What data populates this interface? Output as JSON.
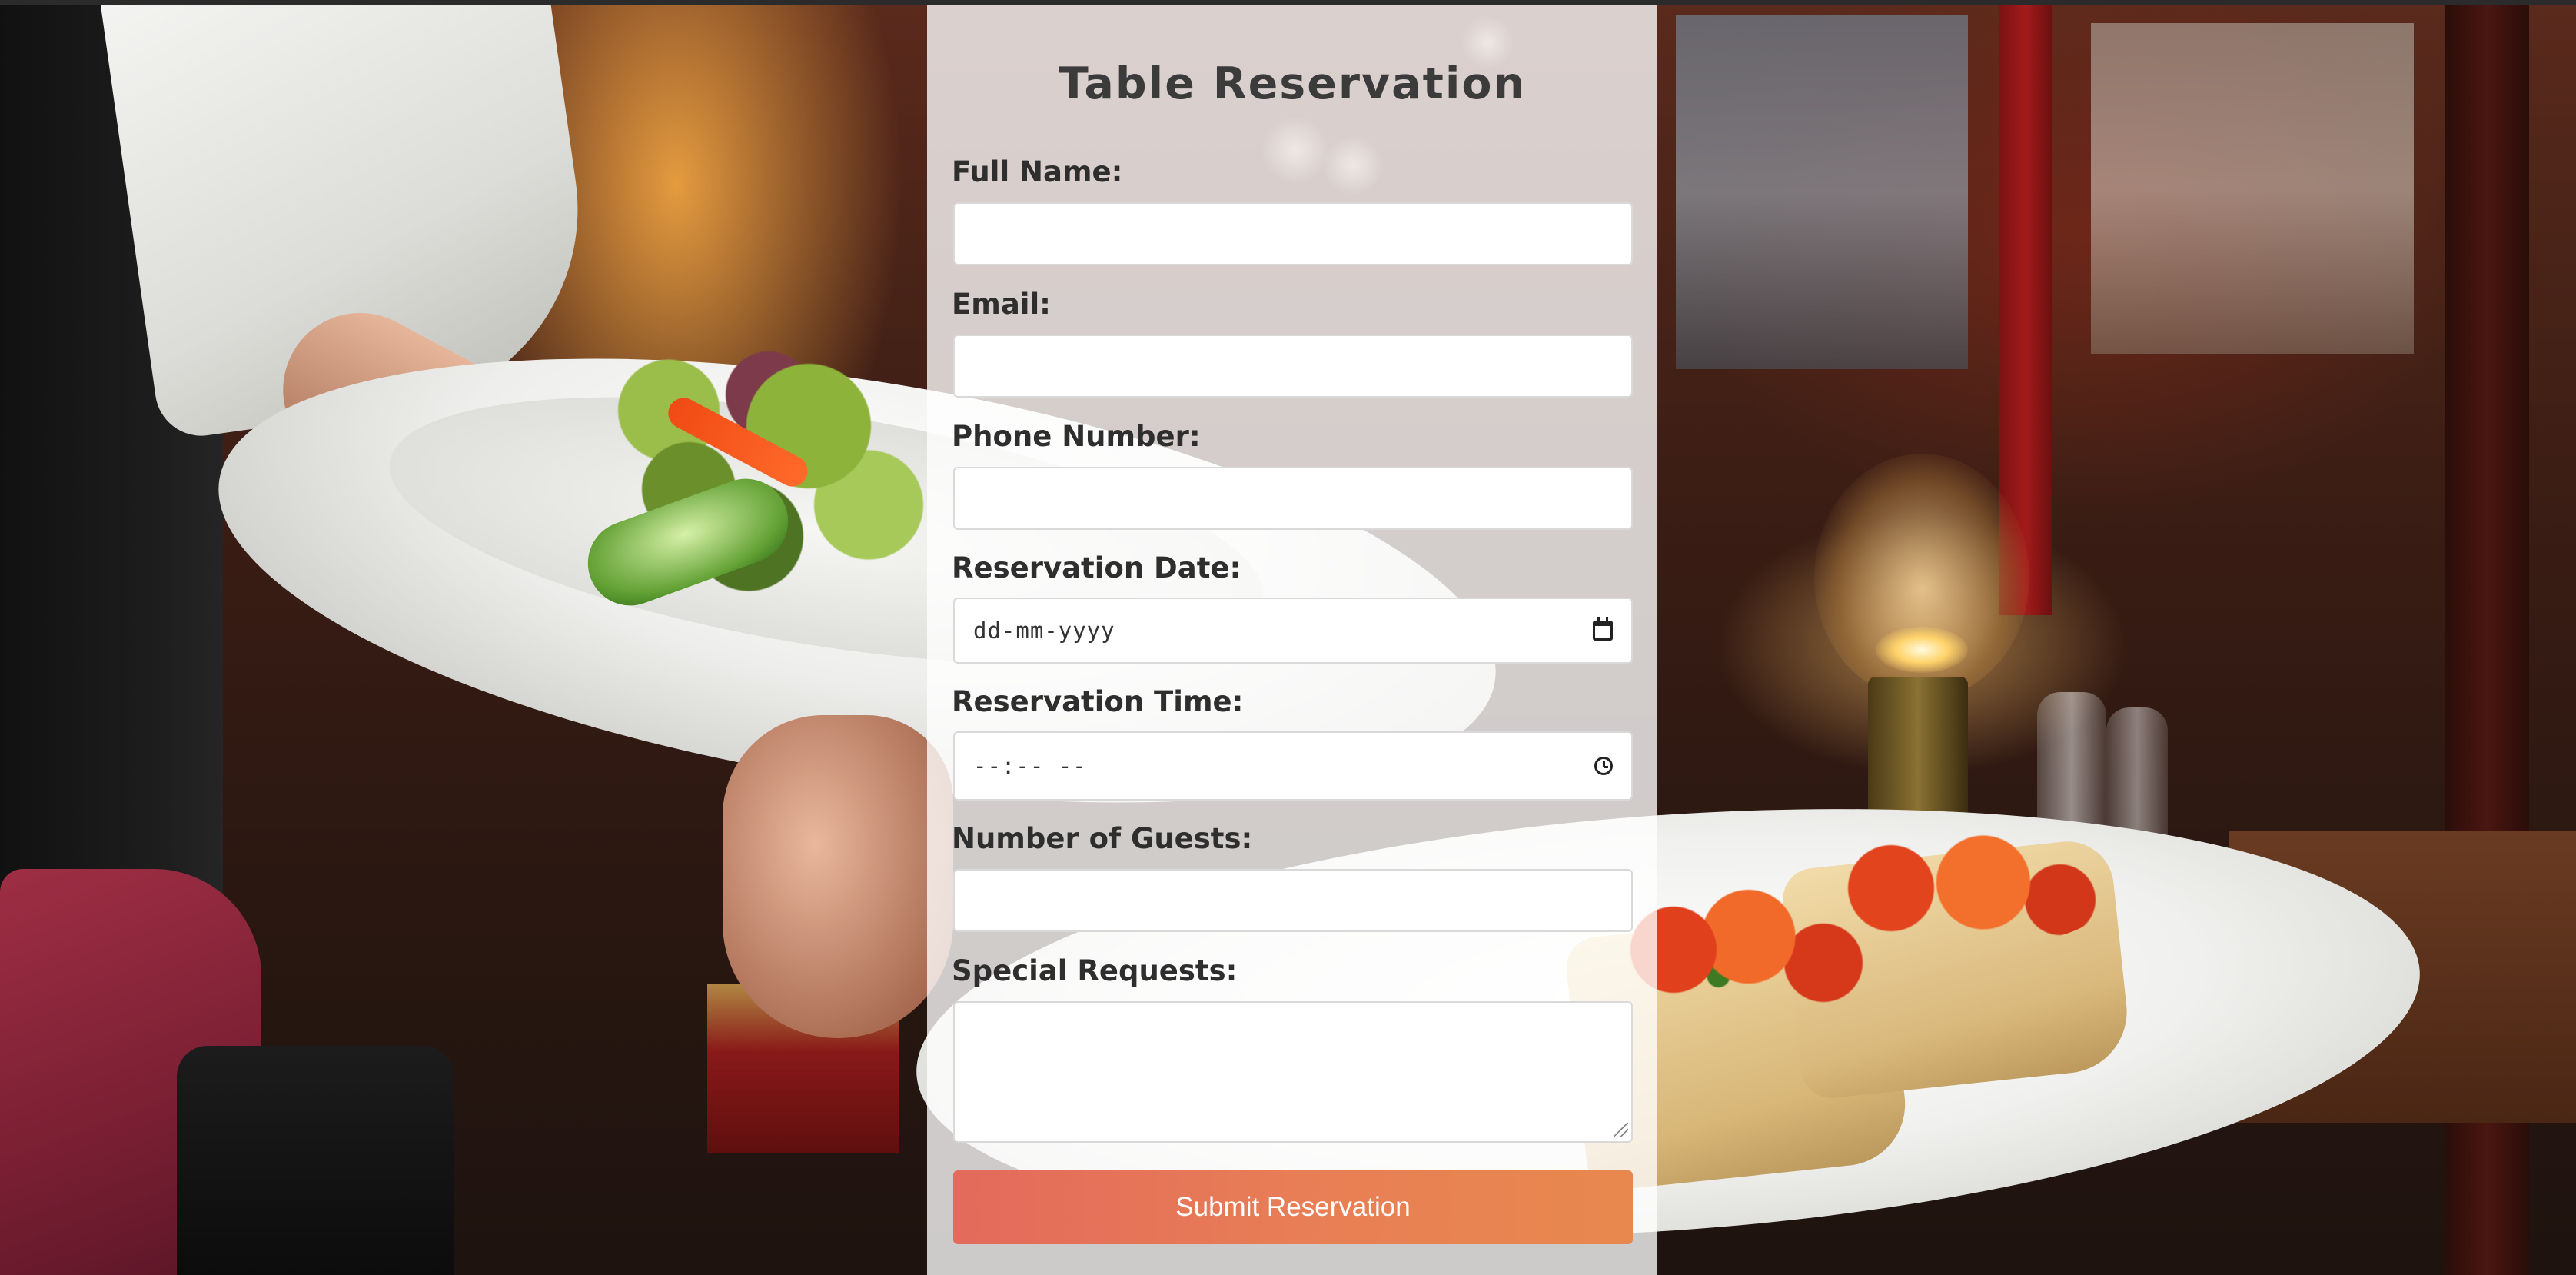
{
  "form": {
    "title": "Table Reservation",
    "fields": {
      "full_name": {
        "label": "Full Name:",
        "value": ""
      },
      "email": {
        "label": "Email:",
        "value": ""
      },
      "phone": {
        "label": "Phone Number:",
        "value": ""
      },
      "date": {
        "label": "Reservation Date:",
        "placeholder": "dd-mm-yyyy",
        "icon": "calendar-icon"
      },
      "time": {
        "label": "Reservation Time:",
        "placeholder": "--:-- --",
        "icon": "clock-icon"
      },
      "guests": {
        "label": "Number of Guests:",
        "value": ""
      },
      "requests": {
        "label": "Special Requests:",
        "value": ""
      }
    },
    "submit_label": "Submit Reservation"
  },
  "colors": {
    "panel_background": "#ffffffc7",
    "title_text": "#3b3b3b",
    "label_text": "#2e2e2e",
    "button_gradient_start": "#e36a5c",
    "button_gradient_end": "#e8884e",
    "button_text": "#ffffff"
  }
}
